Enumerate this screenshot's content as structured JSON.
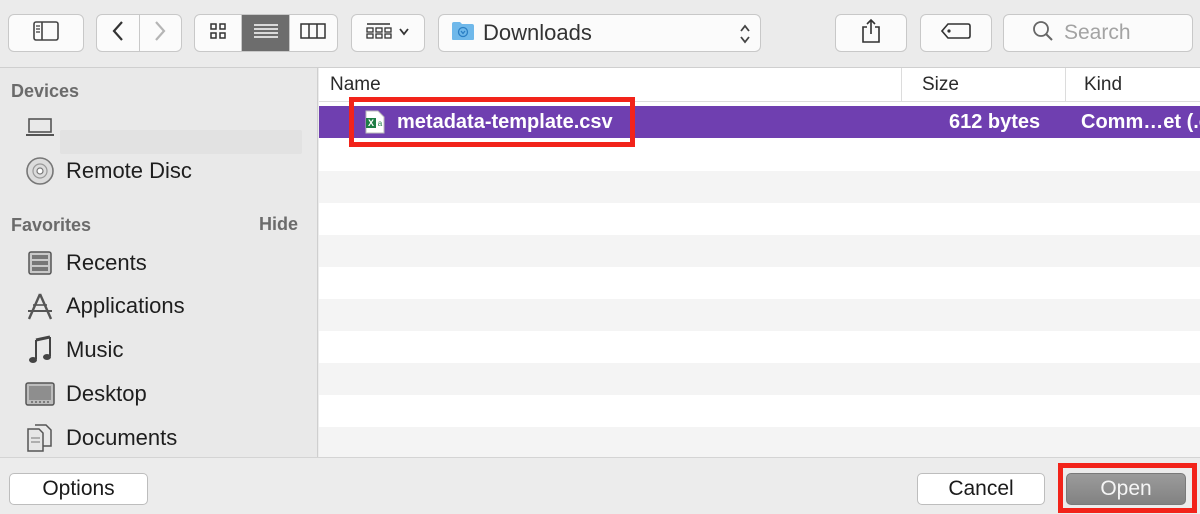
{
  "toolbar": {
    "location_label": "Downloads",
    "search_placeholder": "Search"
  },
  "sidebar": {
    "devices_header": "Devices",
    "devices": [
      {
        "label": "",
        "icon": "laptop-icon"
      },
      {
        "label": "Remote Disc",
        "icon": "disc-icon"
      }
    ],
    "favorites_header": "Favorites",
    "hide_label": "Hide",
    "favorites": [
      {
        "label": "Recents",
        "icon": "recents-icon"
      },
      {
        "label": "Applications",
        "icon": "applications-icon"
      },
      {
        "label": "Music",
        "icon": "music-icon"
      },
      {
        "label": "Desktop",
        "icon": "desktop-icon"
      },
      {
        "label": "Documents",
        "icon": "documents-icon"
      }
    ]
  },
  "filelist": {
    "columns": [
      "Name",
      "Size",
      "Kind"
    ],
    "rows": [
      {
        "name": "metadata-template.csv",
        "size": "612 bytes",
        "kind": "Comm…et (.c",
        "icon": "csv-file-icon",
        "selected": true
      }
    ]
  },
  "footer": {
    "options_label": "Options",
    "cancel_label": "Cancel",
    "open_label": "Open"
  },
  "colors": {
    "selection": "#6f3fb0",
    "highlight_box": "#f2231a",
    "open_button": "#8c8c8c"
  }
}
